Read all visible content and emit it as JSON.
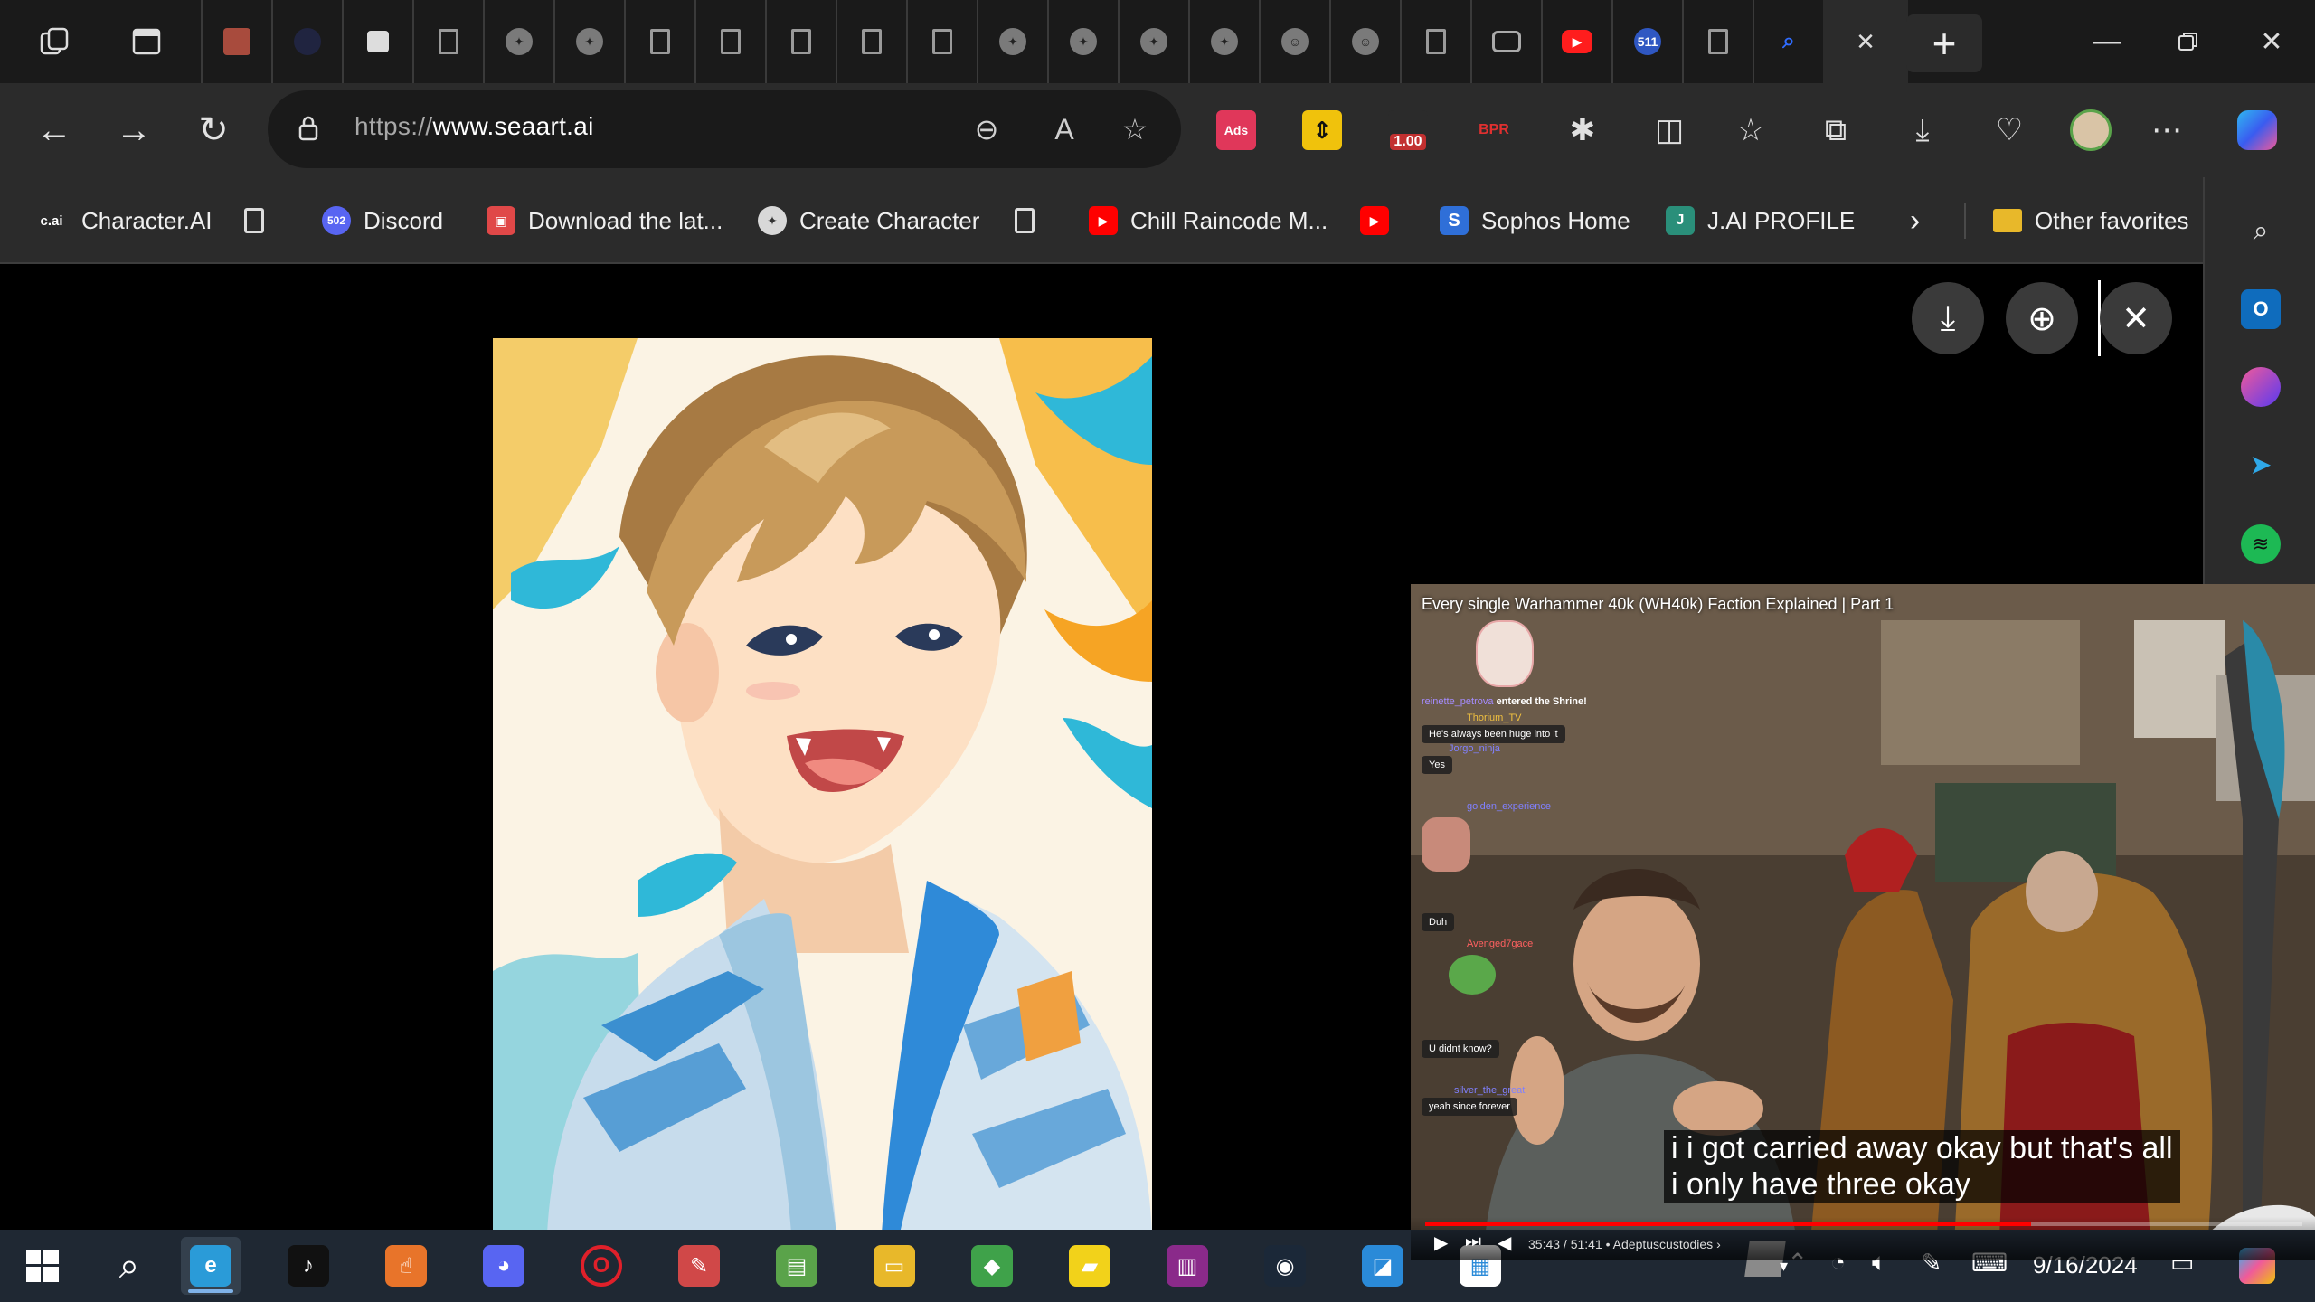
{
  "tabstrip": {
    "tabs": [
      {
        "icon": "notes-icon",
        "kind": "orange",
        "glyph": ""
      },
      {
        "icon": "dark-circle-icon",
        "kind": "dark",
        "glyph": ""
      },
      {
        "icon": "dice-icon",
        "kind": "dice",
        "glyph": ""
      },
      {
        "icon": "page-icon",
        "kind": "doc",
        "glyph": ""
      },
      {
        "icon": "seaart-icon",
        "kind": "",
        "glyph": "✦"
      },
      {
        "icon": "seaart-icon",
        "kind": "",
        "glyph": "✦"
      },
      {
        "icon": "page-icon",
        "kind": "doc",
        "glyph": ""
      },
      {
        "icon": "page-icon",
        "kind": "doc",
        "glyph": ""
      },
      {
        "icon": "page-icon",
        "kind": "doc",
        "glyph": ""
      },
      {
        "icon": "page-icon",
        "kind": "doc",
        "glyph": ""
      },
      {
        "icon": "page-icon",
        "kind": "doc",
        "glyph": ""
      },
      {
        "icon": "seaart-icon",
        "kind": "",
        "glyph": "✦"
      },
      {
        "icon": "seaart-icon",
        "kind": "",
        "glyph": "✦"
      },
      {
        "icon": "seaart-icon",
        "kind": "",
        "glyph": "✦"
      },
      {
        "icon": "seaart-icon",
        "kind": "",
        "glyph": "✦"
      },
      {
        "icon": "character-icon",
        "kind": "",
        "glyph": "☺"
      },
      {
        "icon": "character-icon",
        "kind": "",
        "glyph": "☺"
      },
      {
        "icon": "page-icon",
        "kind": "doc",
        "glyph": ""
      },
      {
        "icon": "gamepad-icon",
        "kind": "game",
        "glyph": ""
      },
      {
        "icon": "youtube-icon",
        "kind": "red",
        "glyph": "▶"
      },
      {
        "icon": "badge-icon",
        "kind": "blue",
        "glyph": "511"
      },
      {
        "icon": "page-icon",
        "kind": "doc",
        "glyph": ""
      },
      {
        "icon": "search-tab-icon",
        "kind": "search",
        "glyph": "⌕"
      }
    ]
  },
  "address": {
    "url_scheme": "https://",
    "url_host": "www.seaart.ai"
  },
  "extensions": {
    "ads_label": "Ads",
    "zoom_badge": "1.00",
    "bpr_label": "BPR"
  },
  "favorites": {
    "items": [
      {
        "name": "fav-character-ai",
        "icon": "c.ai",
        "label": "Character.AI",
        "color": "#2b2b2b"
      },
      {
        "name": "fav-page",
        "icon": "",
        "label": "",
        "color": ""
      },
      {
        "name": "fav-discord",
        "icon": "502",
        "label": "Discord",
        "color": "#5865f2"
      },
      {
        "name": "fav-download",
        "icon": "▣",
        "label": "Download the lat...",
        "color": "#e04848"
      },
      {
        "name": "fav-create-character",
        "icon": "✦",
        "label": "Create Character",
        "color": "#d8d8d8"
      },
      {
        "name": "fav-page-2",
        "icon": "",
        "label": "",
        "color": ""
      },
      {
        "name": "fav-chill-raincode",
        "icon": "▶",
        "label": "Chill Raincode M...",
        "color": "#ff0000"
      },
      {
        "name": "fav-youtube",
        "icon": "▶",
        "label": "",
        "color": "#ff0000"
      },
      {
        "name": "fav-sophos",
        "icon": "S",
        "label": "Sophos Home",
        "color": "#2f6fd8"
      },
      {
        "name": "fav-jai-profile",
        "icon": "J",
        "label": "J.AI PROFILE",
        "color": "#2a8f7a"
      }
    ],
    "other_favorites": "Other favorites"
  },
  "video": {
    "title": "Every single Warhammer 40k (WH40k) Faction Explained | Part 1",
    "caption_line1": "i i got carried away okay but that's all",
    "caption_line2": "i only have three okay",
    "time": "35:43 / 51:41",
    "channel": "• Adeptuscustodies ›",
    "progress_fraction": 0.691,
    "chat": [
      {
        "name": "reinette_petrova",
        "text": "entered the Shrine!"
      },
      {
        "name": "Thorium_TV",
        "text": "He's always been huge into it"
      },
      {
        "name": "Jorgo_ninja",
        "text": "Yes"
      },
      {
        "name": "golden_experience",
        "text": ""
      },
      {
        "name": "",
        "text": "Duh"
      },
      {
        "name": "Avenged7gace",
        "text": ""
      },
      {
        "name": "",
        "text": "U didnt know?"
      },
      {
        "name": "silver_the_great",
        "text": "yeah since forever"
      }
    ]
  },
  "taskbar": {
    "date": "9/16/2024",
    "apps": [
      {
        "name": "taskbar-edge",
        "glyph": "e",
        "color": "#2a9bd8",
        "running": true
      },
      {
        "name": "taskbar-tiktok",
        "glyph": "♪",
        "color": "#111",
        "running": false
      },
      {
        "name": "taskbar-touch-app",
        "glyph": "☝",
        "color": "#e8742a",
        "running": false
      },
      {
        "name": "taskbar-discord",
        "glyph": "◕",
        "color": "#5865f2",
        "running": false
      },
      {
        "name": "taskbar-opera",
        "glyph": "O",
        "color": "#1f2833",
        "running": false
      },
      {
        "name": "taskbar-paint",
        "glyph": "✎",
        "color": "#d04848",
        "running": false
      },
      {
        "name": "taskbar-notepad",
        "glyph": "▤",
        "color": "#5aa34a",
        "running": false
      },
      {
        "name": "taskbar-file-explorer",
        "glyph": "▭",
        "color": "#e8b82a",
        "running": false
      },
      {
        "name": "taskbar-bluestacks",
        "glyph": "◆",
        "color": "#3fa24a",
        "running": false
      },
      {
        "name": "taskbar-sticky-notes",
        "glyph": "▰",
        "color": "#f2d21a",
        "running": false
      },
      {
        "name": "taskbar-winrar",
        "glyph": "▥",
        "color": "#8a2a8a",
        "running": false
      },
      {
        "name": "taskbar-steam",
        "glyph": "◉",
        "color": "#1b2838",
        "running": false
      },
      {
        "name": "taskbar-roblox",
        "glyph": "◪",
        "color": "#2a8ad8",
        "running": false
      },
      {
        "name": "taskbar-store",
        "glyph": "▦",
        "color": "#ffffff",
        "running": false
      }
    ]
  }
}
